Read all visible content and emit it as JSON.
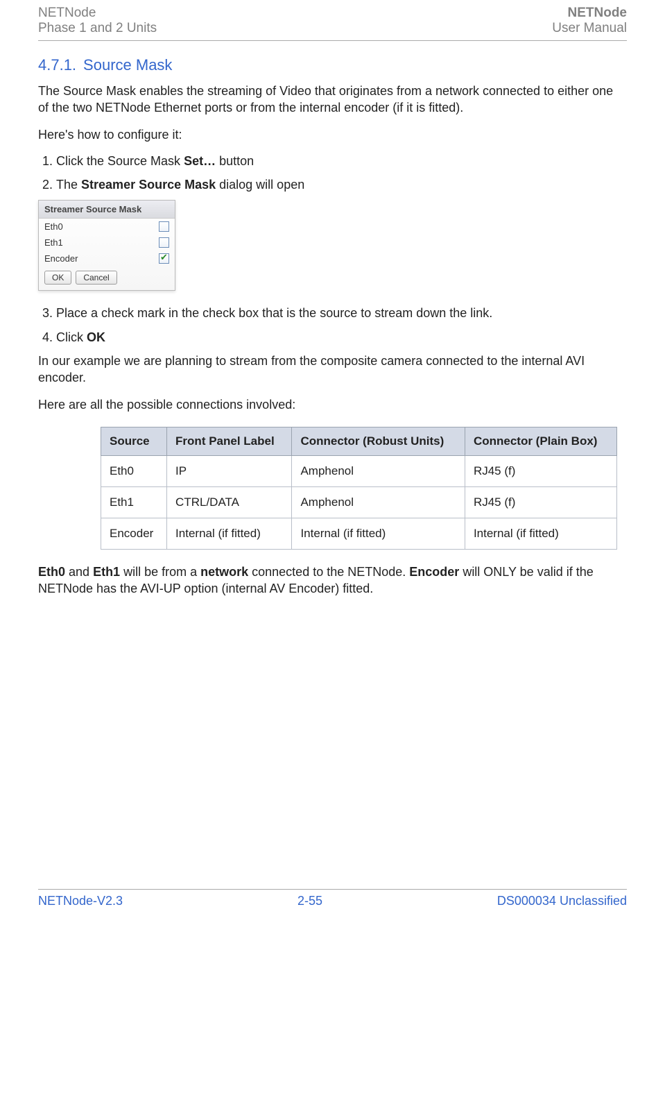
{
  "header": {
    "left_line1": "NETNode",
    "left_line2": "Phase 1 and 2 Units",
    "right_line1": "NETNode",
    "right_line2": "User Manual"
  },
  "section": {
    "number": "4.7.1.",
    "title": "Source Mask"
  },
  "intro": {
    "p1": "The Source Mask enables the streaming of Video that originates from a network connected to either one of the two NETNode Ethernet ports or from the internal encoder (if it is fitted).",
    "p2": "Here's how to configure it:"
  },
  "steps": {
    "s1_pre": "Click the Source Mask ",
    "s1_bold": "Set…",
    "s1_post": " button",
    "s2_pre": "The ",
    "s2_bold": "Streamer Source Mask",
    "s2_post": " dialog will open",
    "s3": "Place a check mark in the check box that is the source to stream down the link.",
    "s4_pre": "Click ",
    "s4_bold": "OK"
  },
  "dialog": {
    "title": "Streamer Source Mask",
    "rows": [
      {
        "label": "Eth0",
        "checked": false
      },
      {
        "label": "Eth1",
        "checked": false
      },
      {
        "label": "Encoder",
        "checked": true
      }
    ],
    "ok": "OK",
    "cancel": "Cancel"
  },
  "after": {
    "p1": "In our example we are planning to stream from the composite camera connected to the internal AVI encoder.",
    "p2": "Here are all the possible connections involved:"
  },
  "table": {
    "headers": {
      "source": "Source",
      "front": "Front Panel Label",
      "robust": "Connector (Robust Units)",
      "plain": "Connector (Plain Box)"
    },
    "rows": [
      {
        "source": "Eth0",
        "front": "IP",
        "robust": "Amphenol",
        "plain": "RJ45 (f)"
      },
      {
        "source": "Eth1",
        "front": "CTRL/DATA",
        "robust": "Amphenol",
        "plain": "RJ45 (f)"
      },
      {
        "source": "Encoder",
        "front": "Internal (if fitted)",
        "robust": "Internal (if fitted)",
        "plain": "Internal (if fitted)"
      }
    ]
  },
  "closing": {
    "b1": "Eth0",
    "t1": " and ",
    "b2": "Eth1",
    "t2": " will be from a ",
    "b3": "network",
    "t3": " connected to the NETNode. ",
    "b4": "Encoder",
    "t4": " will ONLY be valid if the NETNode has the AVI-UP option (internal AV Encoder) fitted."
  },
  "footer": {
    "left": "NETNode-V2.3",
    "mid": "2-55",
    "right": "DS000034 Unclassified"
  }
}
